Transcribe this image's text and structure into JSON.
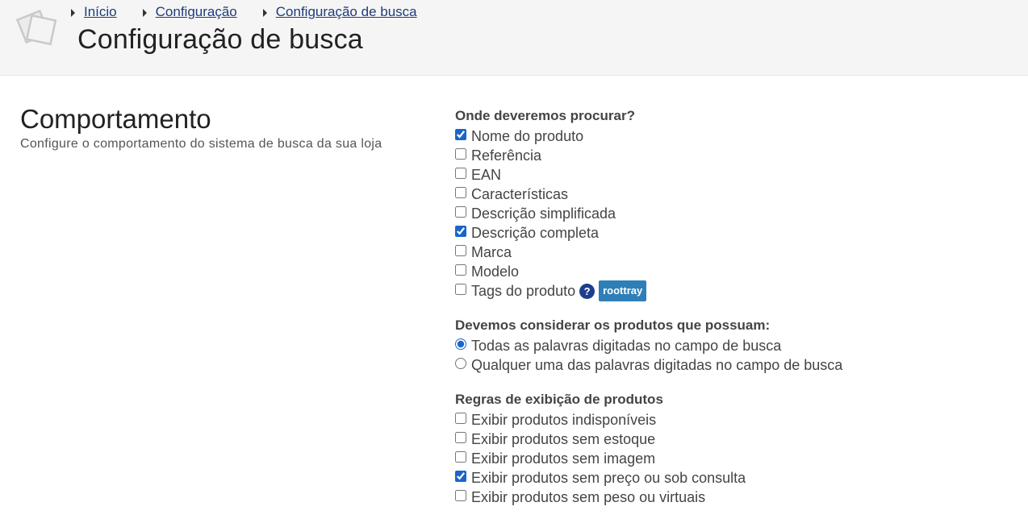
{
  "breadcrumb": [
    {
      "label": "Início"
    },
    {
      "label": "Configuração"
    },
    {
      "label": "Configuração de busca"
    }
  ],
  "page_title": "Configuração de busca",
  "section": {
    "title": "Comportamento",
    "description": "Configure o comportamento do sistema de busca da sua loja"
  },
  "groups": {
    "search_fields": {
      "title": "Onde deveremos procurar?",
      "options": [
        {
          "label": "Nome do produto",
          "checked": true
        },
        {
          "label": "Referência",
          "checked": false
        },
        {
          "label": "EAN",
          "checked": false
        },
        {
          "label": "Características",
          "checked": false
        },
        {
          "label": "Descrição simplificada",
          "checked": false
        },
        {
          "label": "Descrição completa",
          "checked": true
        },
        {
          "label": "Marca",
          "checked": false
        },
        {
          "label": "Modelo",
          "checked": false
        },
        {
          "label": "Tags do produto",
          "checked": false,
          "help": "?",
          "badge": "roottray"
        }
      ]
    },
    "match_mode": {
      "title": "Devemos considerar os produtos que possuam:",
      "options": [
        {
          "label": "Todas as palavras digitadas no campo de busca",
          "checked": true
        },
        {
          "label": "Qualquer uma das palavras digitadas no campo de busca",
          "checked": false
        }
      ]
    },
    "display_rules": {
      "title": "Regras de exibição de produtos",
      "options": [
        {
          "label": "Exibir produtos indisponíveis",
          "checked": false
        },
        {
          "label": "Exibir produtos sem estoque",
          "checked": false
        },
        {
          "label": "Exibir produtos sem imagem",
          "checked": false
        },
        {
          "label": "Exibir produtos sem preço ou sob consulta",
          "checked": true
        },
        {
          "label": "Exibir produtos sem peso ou virtuais",
          "checked": false
        }
      ]
    }
  },
  "colors": {
    "link": "#1f3c7a",
    "badge": "#2e7fb8",
    "help_icon": "#1d3d8f",
    "header_bg": "#f5f5f5"
  }
}
